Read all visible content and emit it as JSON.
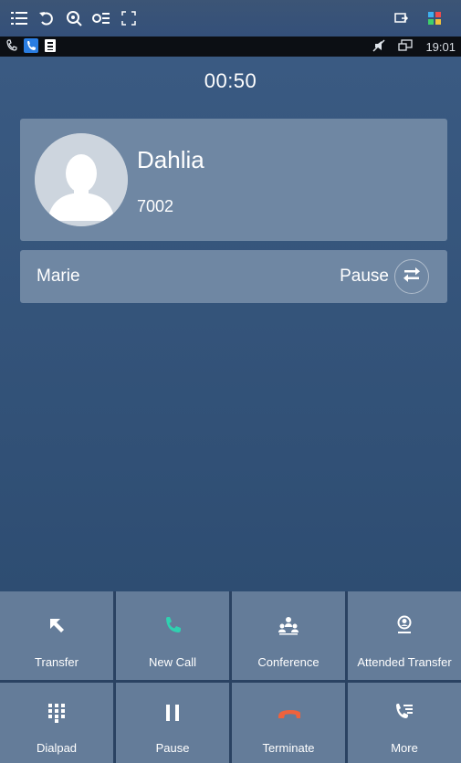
{
  "timer": "00:50",
  "status_bar": {
    "time": "19:01"
  },
  "active_call": {
    "name": "Dahlia",
    "number": "7002"
  },
  "held_call": {
    "name": "Marie",
    "status": "Pause"
  },
  "actions": [
    {
      "label": "Transfer",
      "icon": "transfer-icon"
    },
    {
      "label": "New Call",
      "icon": "phone-icon"
    },
    {
      "label": "Conference",
      "icon": "conference-icon"
    },
    {
      "label": "Attended Transfer",
      "icon": "attended-transfer-icon"
    },
    {
      "label": "Dialpad",
      "icon": "dialpad-icon"
    },
    {
      "label": "Pause",
      "icon": "pause-icon"
    },
    {
      "label": "Terminate",
      "icon": "hangup-icon"
    },
    {
      "label": "More",
      "icon": "more-icon"
    }
  ],
  "colors": {
    "new_call": "#2fd1b0",
    "terminate": "#f0623c"
  }
}
